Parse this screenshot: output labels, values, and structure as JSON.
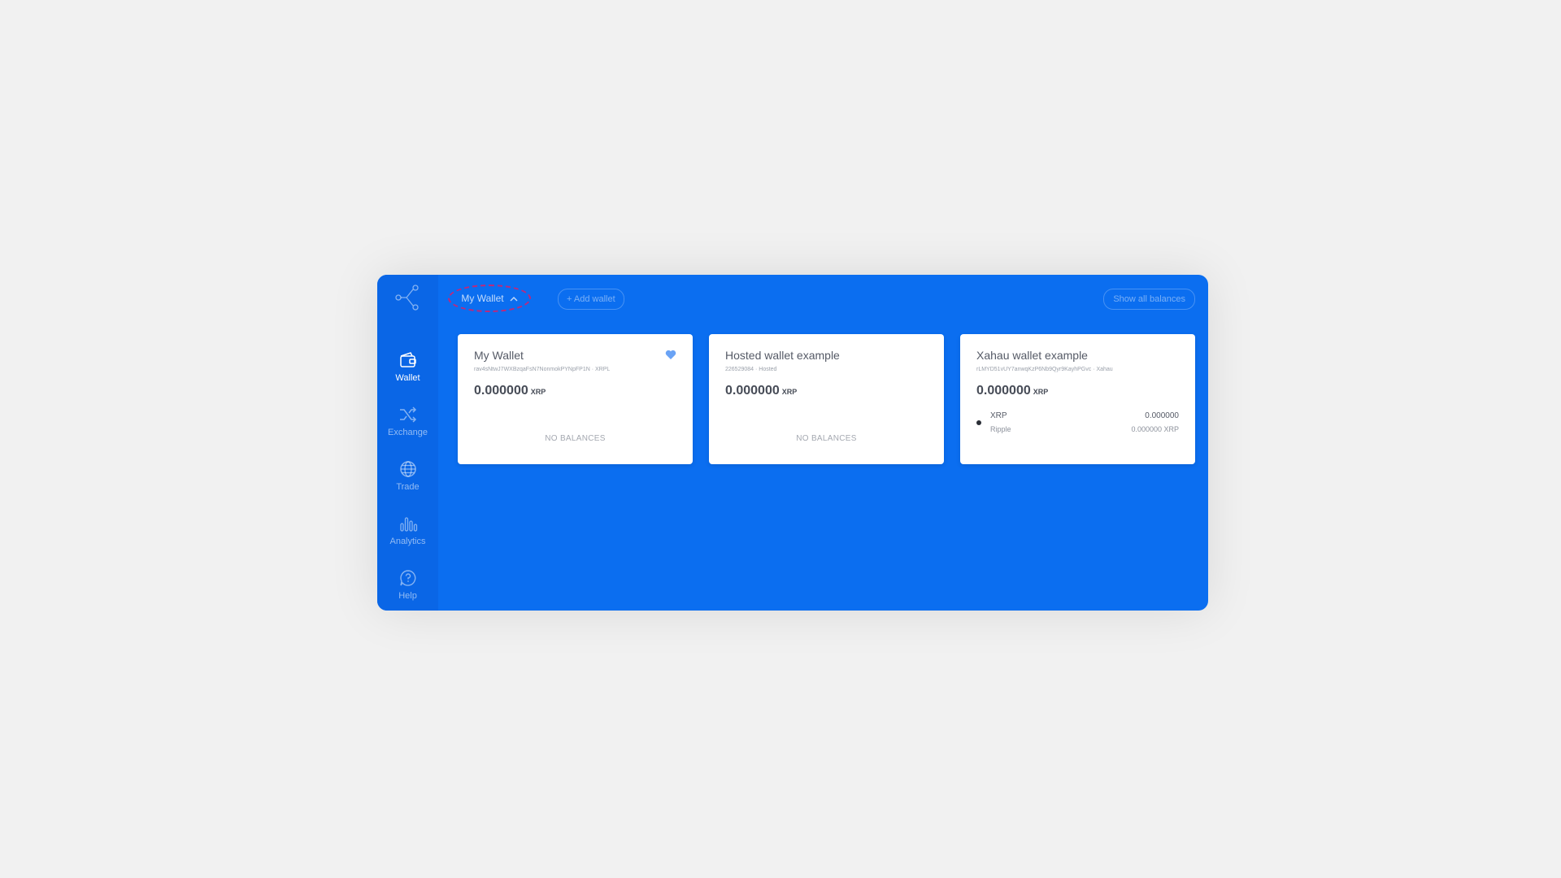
{
  "sidebar": {
    "items": [
      {
        "label": "Wallet",
        "icon": "wallet-icon",
        "active": true
      },
      {
        "label": "Exchange",
        "icon": "shuffle-icon",
        "active": false
      },
      {
        "label": "Trade",
        "icon": "globe-icon",
        "active": false
      },
      {
        "label": "Analytics",
        "icon": "bar-chart-icon",
        "active": false
      },
      {
        "label": "Help",
        "icon": "help-icon",
        "active": false
      }
    ]
  },
  "topbar": {
    "wallet_selector": "My Wallet",
    "add_wallet": "+ Add wallet",
    "show_all_balances": "Show all balances"
  },
  "wallets": [
    {
      "name": "My Wallet",
      "subtitle": "rav4sNtwJ7WXBzqaFsN7NonmokPYNpFP1N · XRPL",
      "balance": "0.000000",
      "currency": "XRP",
      "favorite": true,
      "empty_label": "NO BALANCES"
    },
    {
      "name": "Hosted wallet example",
      "subtitle": "226529084 · Hosted",
      "balance": "0.000000",
      "currency": "XRP",
      "empty_label": "NO BALANCES"
    },
    {
      "name": "Xahau wallet example",
      "subtitle": "rLMYD51vUY7anwqKzP6Nb9Qyr9KayhPGvc · Xahau",
      "balance": "0.000000",
      "currency": "XRP",
      "tokens": [
        {
          "name": "XRP",
          "issuer": "Ripple",
          "amount": "0.000000",
          "value": "0.000000 XRP"
        }
      ]
    }
  ],
  "colors": {
    "app_background": "#0b6ef0",
    "sidebar_background": "#0a66e6",
    "page_background": "#f1f1f1",
    "card_background": "#ffffff",
    "favorite": "#6aa3f5",
    "highlight": "#c0287a"
  }
}
